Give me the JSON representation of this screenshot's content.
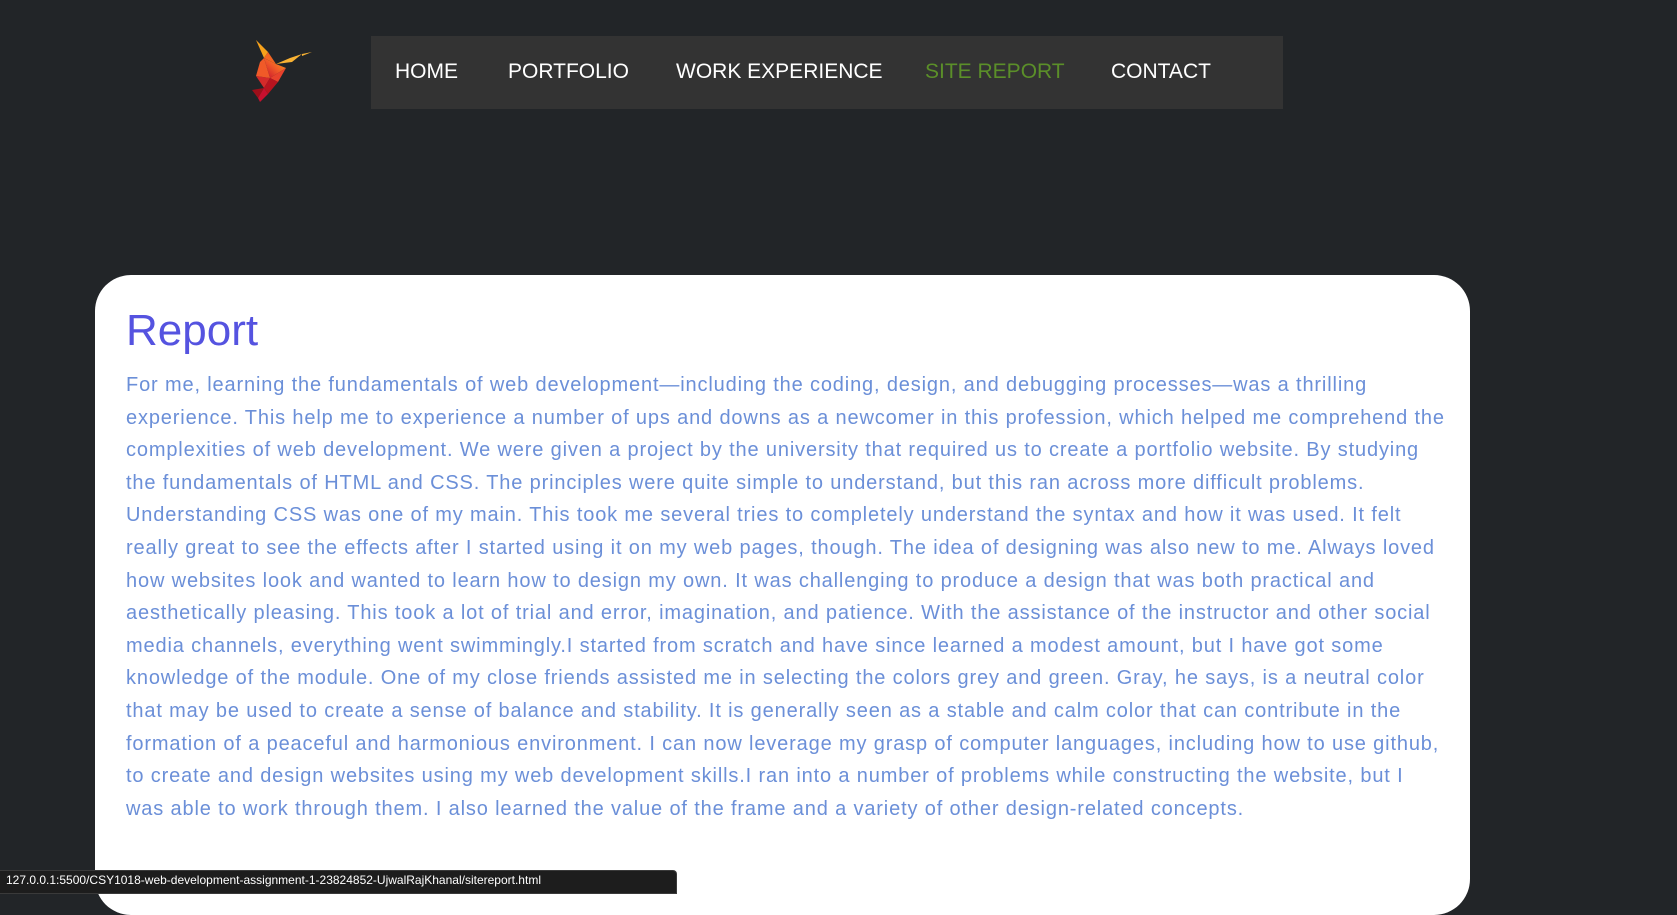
{
  "nav": {
    "items": [
      {
        "label": "HOME",
        "active": false
      },
      {
        "label": "PORTFOLIO",
        "active": false
      },
      {
        "label": "WORK EXPERIENCE",
        "active": false
      },
      {
        "label": "SITE REPORT",
        "active": true
      },
      {
        "label": "CONTACT",
        "active": false
      }
    ],
    "active_color": "#5b8f29",
    "background": "#333333"
  },
  "logo": {
    "icon": "hummingbird-logo-icon"
  },
  "report": {
    "title": "Report",
    "body": "For me, learning the fundamentals of web development—including the coding, design, and debugging processes—was a thrilling experience. This help me to experience a number of ups and downs as a newcomer in this profession, which helped me comprehend the complexities of web development. We were given a project by the university that required us to create a portfolio website. By studying the fundamentals of HTML and CSS. The principles were quite simple to understand, but this ran across more difficult problems. Understanding CSS was one of my main. This took me several tries to completely understand the syntax and how it was used. It felt really great to see the effects after I started using it on my web pages, though. The idea of designing was also new to me. Always loved how websites look and wanted to learn how to design my own. It was challenging to produce a design that was both practical and aesthetically pleasing. This took a lot of trial and error, imagination, and patience. With the assistance of the instructor and other social media channels, everything went swimmingly.I started from scratch and have since learned a modest amount, but I have got some knowledge of the module. One of my close friends assisted me in selecting the colors grey and green. Gray, he says, is a neutral color that may be used to create a sense of balance and stability. It is generally seen as a stable and calm color that can contribute in the formation of a peaceful and harmonious environment. I can now leverage my grasp of computer languages, including how to use github, to create and design websites using my web development skills.I ran into a number of problems while constructing the website, but I was able to work through them. I also learned the value of the frame and a variety of other design-related concepts.",
    "title_color": "#5553e0",
    "text_color": "#6b8fd8"
  },
  "status_bar": {
    "url": "127.0.0.1:5500/CSY1018-web-development-assignment-1-23824852-UjwalRajKhanal/sitereport.html"
  },
  "colors": {
    "page_background": "#222528",
    "card_background": "#ffffff"
  }
}
